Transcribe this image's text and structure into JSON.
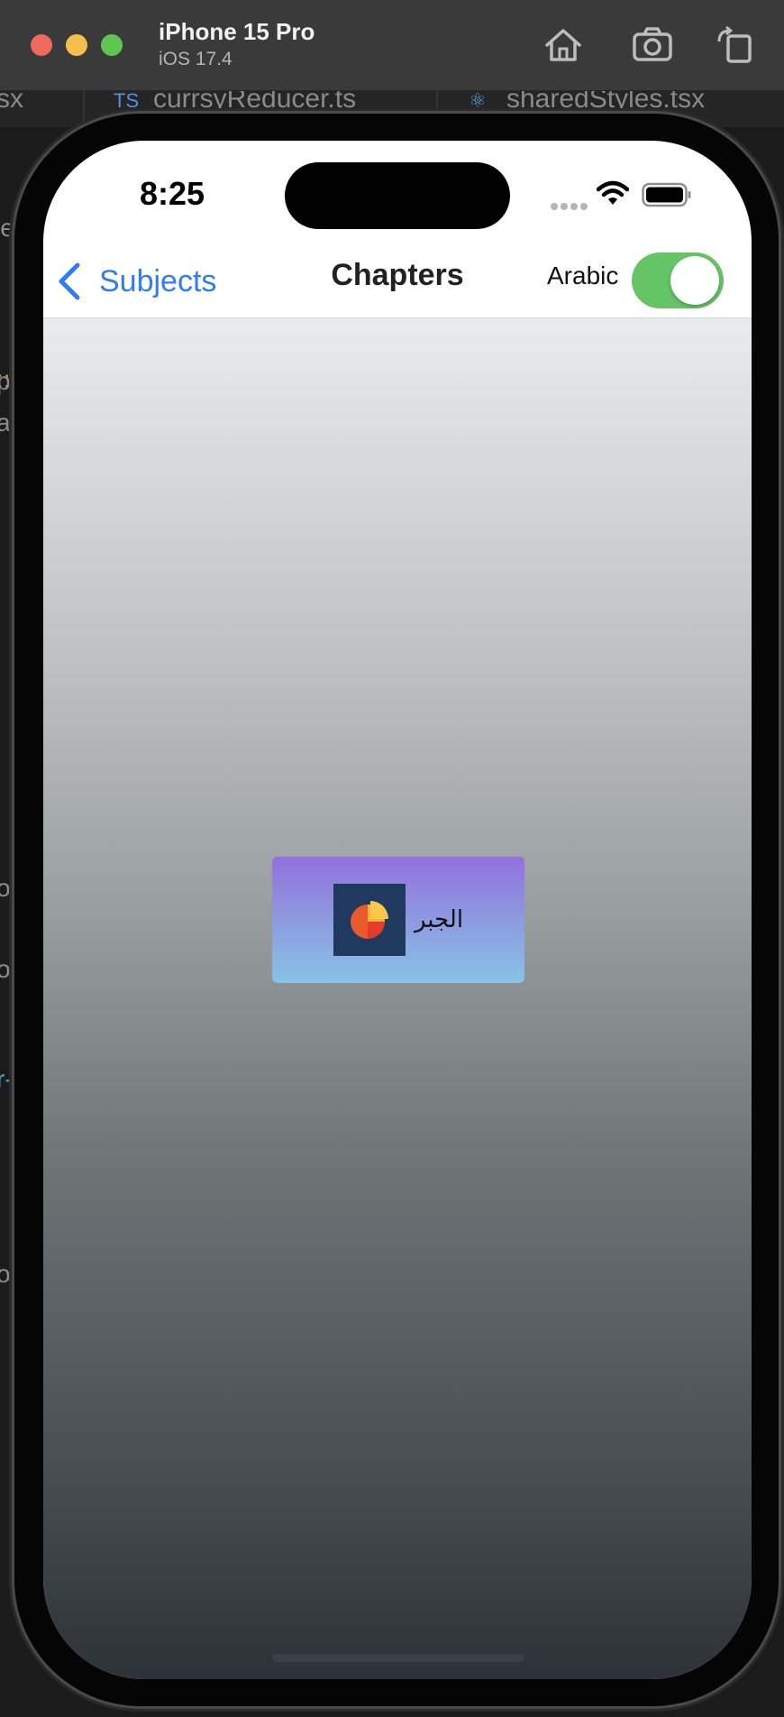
{
  "simulator": {
    "device_name": "iPhone 15 Pro",
    "os_version": "iOS 17.4"
  },
  "editor_tabs": [
    "sx",
    "TS",
    "currsyReducer.ts",
    "sharedStyles.tsx"
  ],
  "status_bar": {
    "time": "8:25"
  },
  "nav": {
    "back_label": "Subjects",
    "title": "Chapters",
    "language_label": "Arabic",
    "arabic_enabled": true
  },
  "chapters": [
    {
      "title": "الجبر",
      "icon": "pie-chart-icon"
    }
  ],
  "colors": {
    "accent": "#2f7cf6",
    "toggle_on": "#65c466",
    "card_gradient_top": "#9370db",
    "card_gradient_bottom": "#88c3e7",
    "thumb_bg": "#1f3a5e"
  }
}
